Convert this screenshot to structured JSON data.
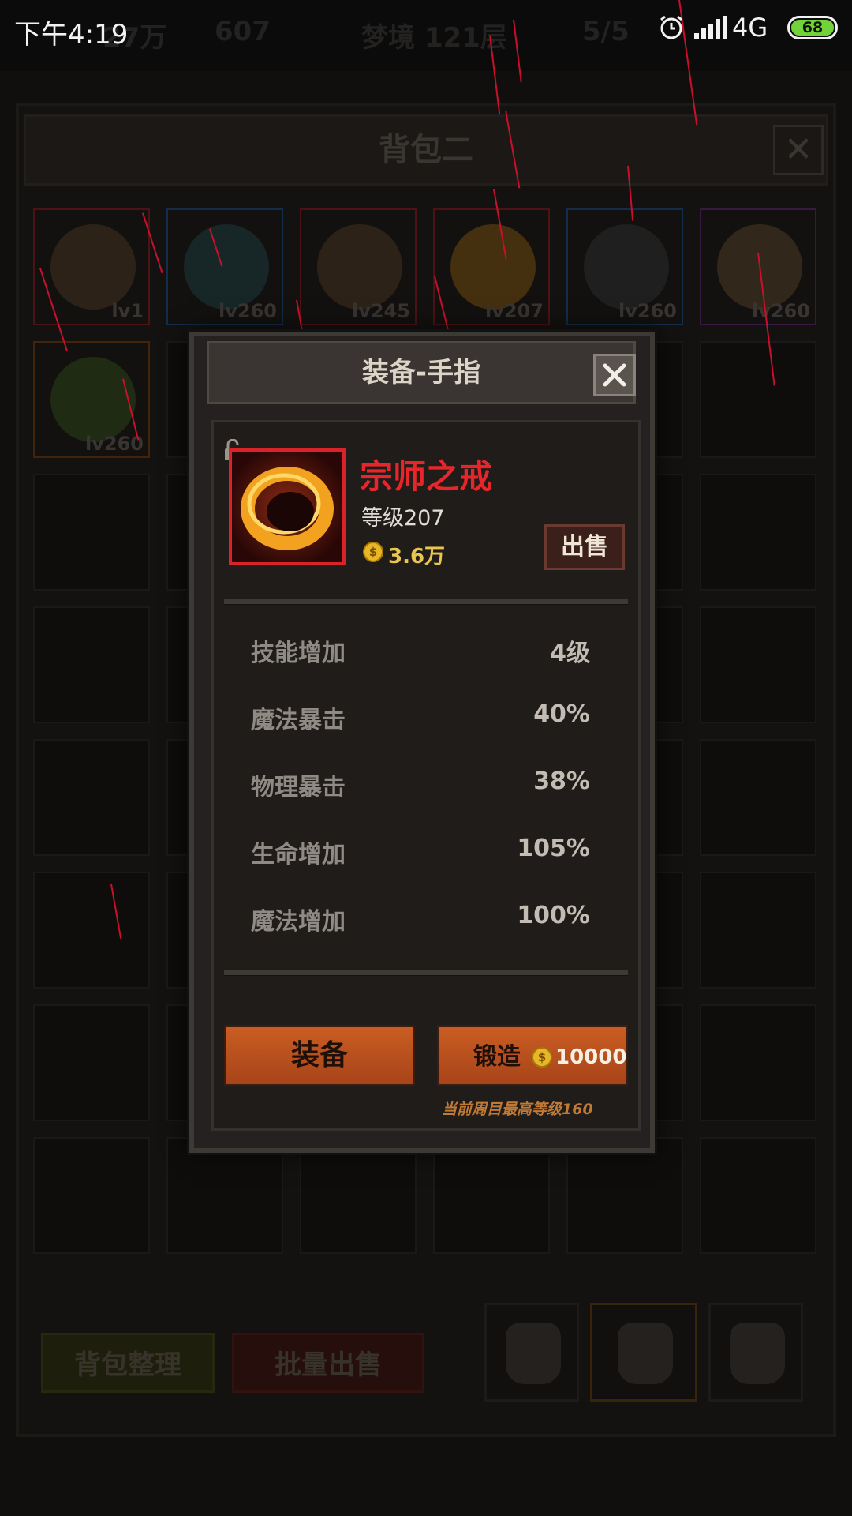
{
  "status_bar": {
    "time": "下午4:19",
    "network": "4G",
    "battery": "68"
  },
  "hud": {
    "gold": "27万",
    "gems": "607",
    "dream": "梦境 121层",
    "progress": "5/5"
  },
  "bag": {
    "title": "背包二",
    "items": [
      {
        "level": "lv1",
        "kind": "shield"
      },
      {
        "level": "lv260",
        "kind": "orb"
      },
      {
        "level": "lv245",
        "kind": "shield"
      },
      {
        "level": "lv207",
        "kind": "ring"
      },
      {
        "level": "lv260",
        "kind": "armor"
      },
      {
        "level": "lv260",
        "kind": "feather"
      },
      {
        "level": "lv260",
        "kind": "gun"
      }
    ],
    "sort_label": "背包整理",
    "bulk_sell_label": "批量出售"
  },
  "modal": {
    "title": "装备-手指",
    "item_name": "宗师之戒",
    "item_level": "等级207",
    "item_price": "3.6万",
    "sell_label": "出售",
    "stats": [
      {
        "label": "技能增加",
        "value": "4级"
      },
      {
        "label": "魔法暴击",
        "value": "40%"
      },
      {
        "label": "物理暴击",
        "value": "38%"
      },
      {
        "label": "生命增加",
        "value": "105%"
      },
      {
        "label": "魔法增加",
        "value": "100%"
      }
    ],
    "equip_label": "装备",
    "forge_label": "锻造",
    "forge_cost": "10000",
    "forge_note": "当前周目最高等级160"
  },
  "colors": {
    "item_name_red": "#e8262a",
    "button_orange": "#c95d22",
    "gold": "#eac64f",
    "note_orange": "#c17a36"
  },
  "icons": [
    "alarm-icon",
    "signal-icon",
    "battery-icon",
    "close-icon",
    "lock-icon",
    "coin-icon",
    "backpack-icon"
  ]
}
